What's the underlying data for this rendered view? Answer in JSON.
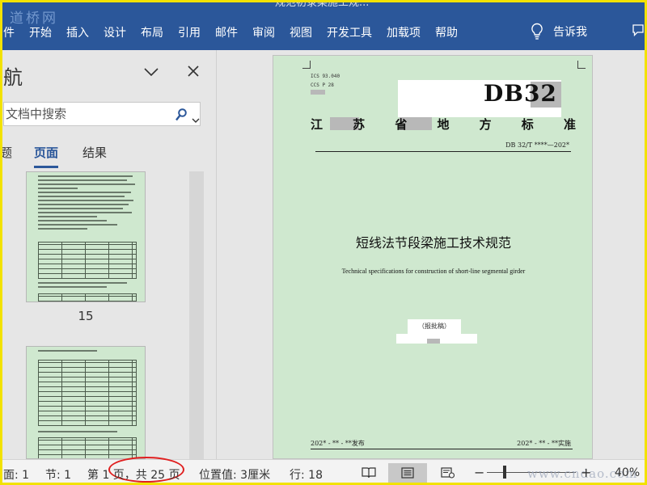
{
  "titlebar": {
    "watermark": "道桥网",
    "doc_title": "规范初录梁施工规..."
  },
  "menu": [
    "件",
    "开始",
    "插入",
    "设计",
    "布局",
    "引用",
    "邮件",
    "审阅",
    "视图",
    "开发工具",
    "加载项",
    "帮助"
  ],
  "tell_me": "告诉我",
  "nav": {
    "title": "航",
    "search_placeholder": "文档中搜索",
    "tabs": [
      "题",
      "页面",
      "结果"
    ],
    "thumb_labels": [
      "15"
    ]
  },
  "document": {
    "ics": "ICS 93.040",
    "ccs": "CCS P 28",
    "db_code": "DB32",
    "province_chars": [
      "江",
      "苏",
      "省",
      "地",
      "方",
      "标",
      "准"
    ],
    "std_no": "DB 32/T ****—202*",
    "cn_title": "短线法节段梁施工技术规范",
    "en_title": "Technical specifications for construction of short-line segmental girder",
    "approve": "（报批稿）",
    "publish": "202* - ** - **发布",
    "implement": "202* - ** - **实施"
  },
  "status": {
    "section_page": "面: 1",
    "section": "节: 1",
    "page_of": "第 1 页，共 25 页",
    "position": "位置值: 3厘米",
    "line": "行: 18",
    "zoom": "40%",
    "site": "www.cndao.com"
  },
  "colors": {
    "ribbon": "#2b579a",
    "page_green": "#cfe8cf",
    "highlight": "#e02020",
    "frame": "#f2e200"
  }
}
